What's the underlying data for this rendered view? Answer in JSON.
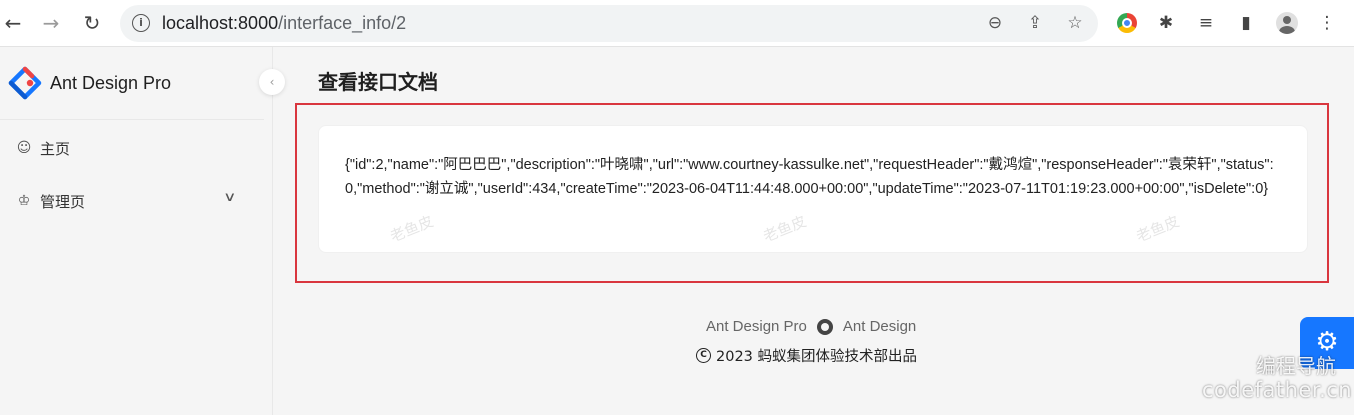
{
  "browser": {
    "url_host": "localhost:8000",
    "url_path": "/interface_info/2",
    "icons": [
      "back-arrow-icon",
      "forward-arrow-icon",
      "reload-icon",
      "site-info-icon",
      "zoom-icon",
      "share-icon",
      "bookmark-star-icon",
      "chrome-extension-icon",
      "puzzle-icon",
      "reading-list-icon",
      "side-panel-icon",
      "profile-icon",
      "kebab-menu-icon"
    ]
  },
  "sidebar": {
    "brand_title": "Ant Design Pro",
    "items": [
      {
        "label": "主页",
        "icon": "smile-icon"
      },
      {
        "label": "管理页",
        "icon": "crown-icon",
        "has_submenu": true
      }
    ]
  },
  "main": {
    "page_title": "查看接口文档",
    "content_text": "{\"id\":2,\"name\":\"阿巴巴巴\",\"description\":\"叶晓啸\",\"url\":\"www.courtney-kassulke.net\",\"requestHeader\":\"戴鸿煊\",\"responseHeader\":\"袁荣轩\",\"status\":0,\"method\":\"谢立诚\",\"userId\":434,\"createTime\":\"2023-06-04T11:44:48.000+00:00\",\"updateTime\":\"2023-07-11T01:19:23.000+00:00\",\"isDelete\":0}",
    "watermark": "老鱼皮",
    "highlight_color": "#d9363e"
  },
  "footer": {
    "link_1": "Ant Design Pro",
    "link_2": "Ant Design",
    "copyright": "2023 蚂蚁集团体验技术部出品"
  },
  "overlay": {
    "settings_icon": "gear-icon",
    "site_watermark_1": "编程导航",
    "site_watermark_2": "codefather.cn"
  },
  "colors": {
    "primary": "#1677ff",
    "background": "#f5f5f5"
  }
}
